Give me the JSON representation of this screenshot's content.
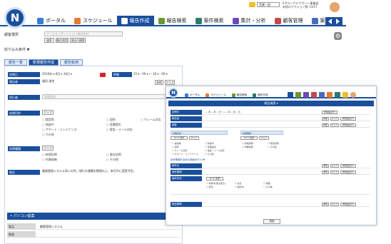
{
  "app": {
    "logo_letter": "N",
    "nav": [
      {
        "label": "ポータル",
        "icon": "portal-icon",
        "color": "#3a7bd5"
      },
      {
        "label": "スケジュール",
        "icon": "schedule-icon",
        "color": "#e57b2d"
      },
      {
        "label": "報告作成",
        "icon": "report-create-icon",
        "color": "#ffffff",
        "active": true
      },
      {
        "label": "報告検索",
        "icon": "report-search-icon",
        "color": "#6a9a2e"
      },
      {
        "label": "案件検索",
        "icon": "case-search-icon",
        "color": "#2e7a6a"
      },
      {
        "label": "集計・分析",
        "icon": "analysis-icon",
        "color": "#6c4ab6"
      },
      {
        "label": "顧客管理",
        "icon": "customer-icon",
        "color": "#c24a4a"
      },
      {
        "label": "案件管理",
        "icon": "case-manage-icon",
        "color": "#4a6ac2"
      }
    ],
    "user_select": "営業一部",
    "user_text": "E-Pコンサルサポート事業部",
    "user_text2": "未読のアクション数 13/17"
  },
  "page": {
    "customer_label": "顧客選択",
    "customer_value": "アースコーポレーション株式会社",
    "btn_search": "検索",
    "btn_recent": "最近使用",
    "btn_select": "過去1週間",
    "filter_label": "絞り込み条件 ▼",
    "tabs": [
      "報告一覧",
      "新規報告作成",
      "報告転用"
    ],
    "fields": [
      {
        "label": "訪問日",
        "value": "2016年 ▾ 8月 ▾ 16日 ▾"
      },
      {
        "label": "報告者",
        "value": "福田 達也"
      },
      {
        "label": "同行者",
        "value": "試験追加"
      },
      {
        "label": "訪問目的",
        "value": "クリア"
      },
      {
        "label": "訪問種類",
        "value": "クリア"
      },
      {
        "label": "報告",
        "value": "業務管理システム導入の件。現行の課題を整理の上、来月中に提案予定。"
      }
    ],
    "time_label": "時間",
    "time_value": "15 ▾ : 00 ▾ ～ 16 ▾ : 00 ▾",
    "btn_ref": "参照",
    "btn_clear": "クリア",
    "purpose_options": [
      "提案等",
      "商談中",
      "サポート・メンテナンス",
      "その他",
      "契約",
      "見積提出",
      "クレーム対応",
      "電話・メール対応"
    ],
    "type_options": [
      "新規訪問",
      "作業依頼",
      "既存訪問",
      "その他"
    ],
    "pc_section": "• パソコン提案",
    "pc_rows": [
      {
        "k": "製品",
        "v": "顧客管理システム"
      },
      {
        "k": "数量",
        "v": ""
      }
    ]
  },
  "front": {
    "nav": [
      {
        "label": "ポータル",
        "color": "#3a7bd5"
      },
      {
        "label": "スケジュール",
        "color": "#e57b2d"
      },
      {
        "label": "報告検索",
        "color": "#6a9a2e"
      },
      {
        "label": "案件作成",
        "color": "#2e7a6a"
      }
    ],
    "header": "報告検索 ▾",
    "rows": [
      {
        "label": "訪問日",
        "value": "---- 年 -- 月 -- 日 ～ ---- 年 -- 月 -- 日"
      },
      {
        "label": "報告者",
        "value": ""
      },
      {
        "label": "顧客",
        "value": ""
      },
      {
        "label": "訪問目的",
        "value": ""
      },
      {
        "label": "報告キーワード",
        "value": ""
      }
    ],
    "btn_ref": "参照",
    "btn_clear": "クリア",
    "btn_ref2": "参照設定(F)",
    "btn_select_all": "すべて選択",
    "purpose_head": "訪問目的",
    "type_head": "訪問種類",
    "purpose_cbs": [
      "提案等",
      "商談中",
      "契約",
      "見積提出",
      "クレーム対応",
      "電話・メール対応",
      "サポート・メンテナンス",
      "その他"
    ],
    "type_cbs": [
      "新規訪問",
      "既存訪問",
      "作業依頼",
      "その他"
    ],
    "more_label": "状況情報を含めた検索を行う ▼",
    "status_rows": [
      {
        "label": "案件名",
        "value": ""
      },
      {
        "label": "案件期間",
        "value": ""
      },
      {
        "label": "案件状況",
        "value": ""
      },
      {
        "label": "報告期間",
        "value": ""
      }
    ],
    "status_cbs": [
      "商談中(受注見込)",
      "失注",
      "保留",
      "受注",
      "検討中",
      "その他"
    ],
    "search_btn": "検索"
  },
  "colors": {
    "brand": "#1a4f9c",
    "accent_red": "#d9232d"
  }
}
